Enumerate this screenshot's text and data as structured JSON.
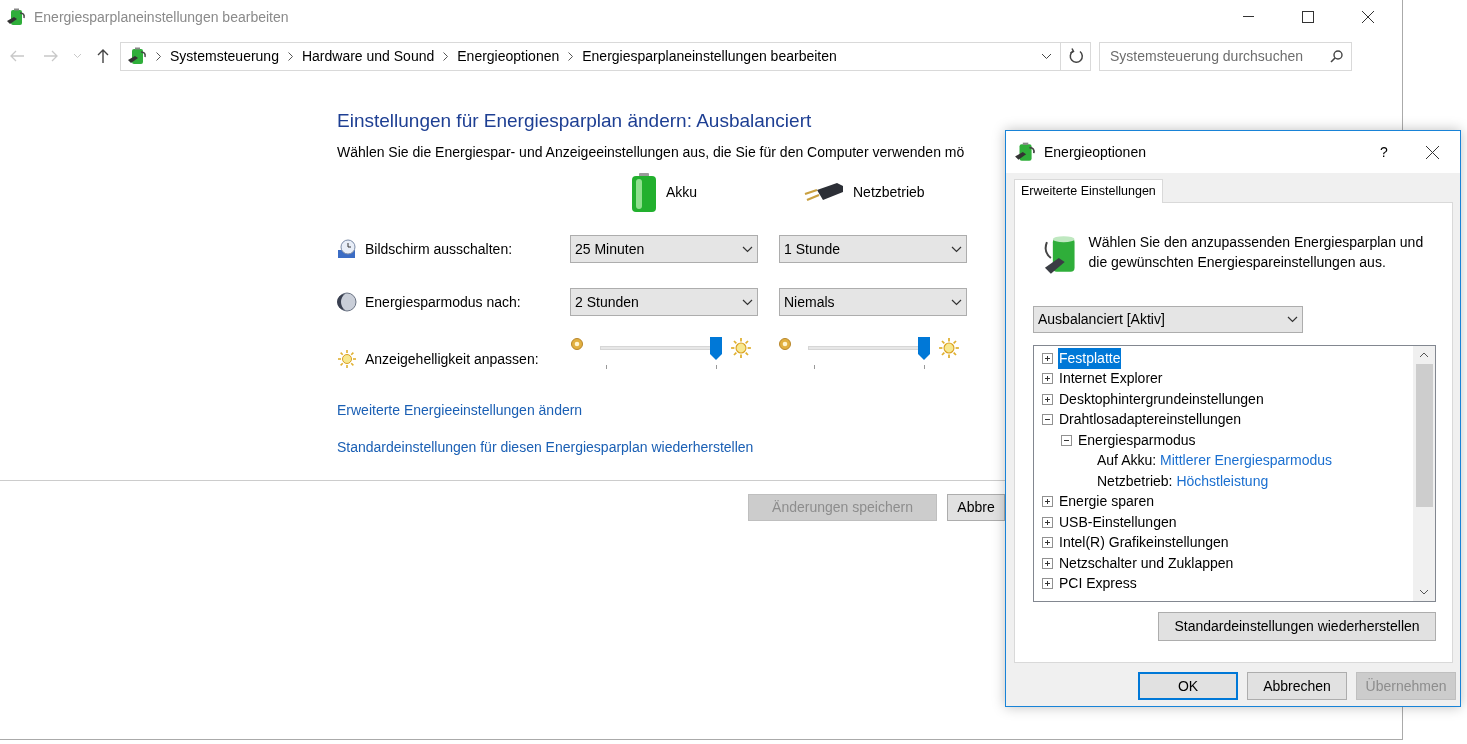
{
  "window": {
    "title": "Energiesparplaneinstellungen bearbeiten"
  },
  "breadcrumbs": [
    "Systemsteuerung",
    "Hardware und Sound",
    "Energieoptionen",
    "Energiesparplaneinstellungen bearbeiten"
  ],
  "search": {
    "placeholder": "Systemsteuerung durchsuchen"
  },
  "heading": "Einstellungen für Energiesparplan ändern: Ausbalanciert",
  "subtitle": "Wählen Sie die Energiespar- und Anzeigeeinstellungen aus, die Sie für den Computer verwenden mö",
  "columns": [
    "Akku",
    "Netzbetrieb"
  ],
  "settings": [
    {
      "kind": "select",
      "label": "Bildschirm ausschalten:",
      "battery": "25 Minuten",
      "ac": "1 Stunde"
    },
    {
      "kind": "select",
      "label": "Energiesparmodus nach:",
      "battery": "2 Stunden",
      "ac": "Niemals"
    },
    {
      "kind": "slider",
      "label": "Anzeigehelligkeit anpassen:",
      "battery": {
        "level": 1.0
      },
      "ac": {
        "level": 1.0
      }
    }
  ],
  "links": [
    "Erweiterte Energieeinstellungen ändern",
    "Standardeinstellungen für diesen Energiesparplan wiederherstellen"
  ],
  "buttons": [
    {
      "label": "Änderungen speichern",
      "disabled": true
    },
    {
      "label": "Abbre",
      "disabled": false
    }
  ],
  "dialog": {
    "title": "Energieoptionen",
    "help": "?",
    "tabs": [
      {
        "label": "Erweiterte Einstellungen",
        "selected": true
      }
    ],
    "description": "Wählen Sie den anzupassenden Energiesparplan und die gewünschten Energiespareinstellungen aus.",
    "plan": "Ausbalanciert [Aktiv]",
    "tree": [
      {
        "label": "Festplatte",
        "expanded": false,
        "selected": true
      },
      {
        "label": "Internet Explorer",
        "expanded": false,
        "selected": false
      },
      {
        "label": "Desktophintergrundeinstellungen",
        "expanded": false,
        "selected": false
      },
      {
        "label": "Drahtlosadaptereinstellungen",
        "expanded": true,
        "selected": false,
        "children": [
          {
            "label": "Energiesparmodus",
            "expanded": true,
            "selected": false,
            "children": [
              {
                "kind": "setting",
                "label": "Auf Akku:",
                "value": "Mittlerer Energiesparmodus",
                "selected": false
              },
              {
                "kind": "setting",
                "label": "Netzbetrieb:",
                "value": "Höchstleistung",
                "selected": false
              }
            ]
          }
        ]
      },
      {
        "label": "Energie sparen",
        "expanded": false,
        "selected": false
      },
      {
        "label": "USB-Einstellungen",
        "expanded": false,
        "selected": false
      },
      {
        "label": "Intel(R) Grafikeinstellungen",
        "expanded": false,
        "selected": false
      },
      {
        "label": "Netzschalter und Zuklappen",
        "expanded": false,
        "selected": false
      },
      {
        "label": "PCI Express",
        "expanded": false,
        "selected": false
      }
    ],
    "restore_button": "Standardeinstellungen wiederherstellen",
    "buttons": [
      {
        "label": "OK",
        "kind": "default",
        "disabled": false
      },
      {
        "label": "Abbrechen",
        "kind": "normal",
        "disabled": false
      },
      {
        "label": "Übernehmen",
        "kind": "normal",
        "disabled": true
      }
    ]
  }
}
